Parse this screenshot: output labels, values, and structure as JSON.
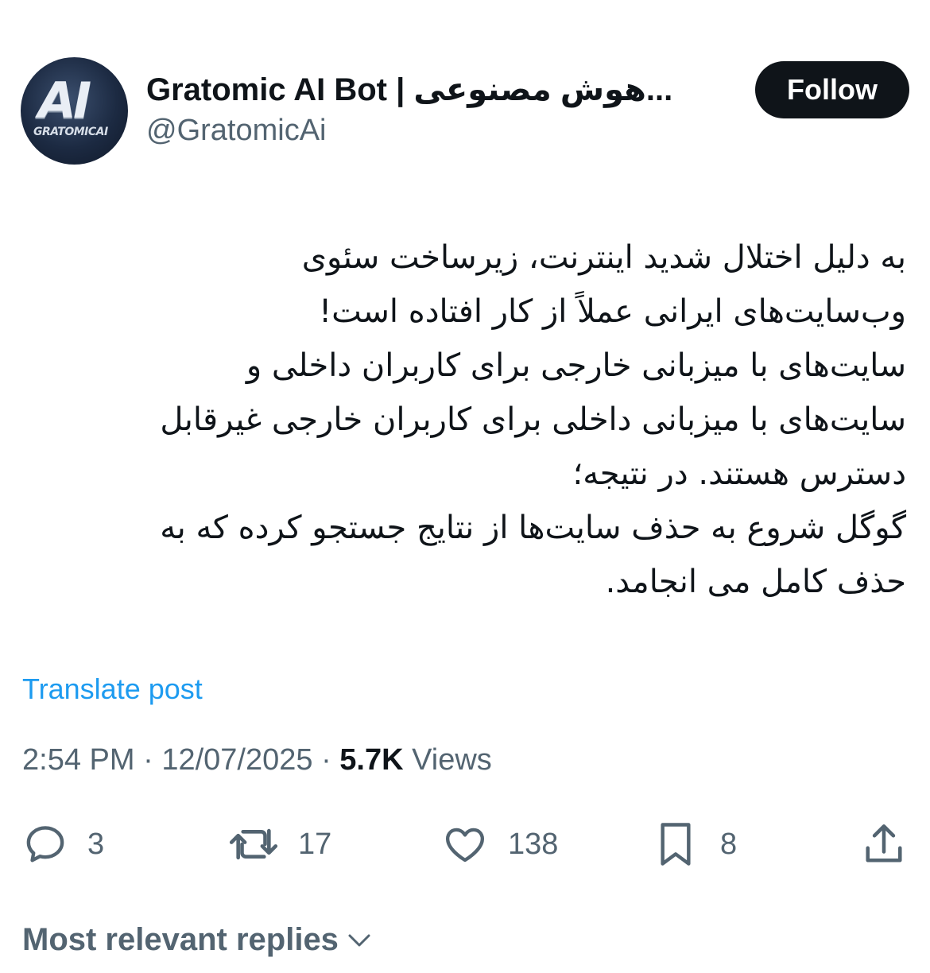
{
  "author": {
    "avatar_text": "AI",
    "avatar_brand": "GRATOMICAI",
    "display_name": "Gratomic AI Bot | هوش مصنوعی...",
    "handle": "@GratomicAi"
  },
  "follow_label": "Follow",
  "tweet": {
    "text": "به دلیل اختلال شدید اینترنت، زیرساخت سئوی\nوب‌سایت‌های ایرانی عملاً از کار افتاده است!\nسایت‌های با میزبانی خارجی برای کاربران داخلی و\nسایت‌های با میزبانی داخلی برای کاربران خارجی غیرقابل\nدسترس هستند. در نتیجه؛\nگوگل شروع به حذف سایت‌ها از نتایج جستجو کرده که به\nحذف کامل می انجامد."
  },
  "translate_label": "Translate post",
  "meta": {
    "time": "2:54 PM",
    "date": "12/07/2025",
    "views_count": "5.7K",
    "views_label": "Views",
    "separator": "·"
  },
  "actions": {
    "replies": "3",
    "reposts": "17",
    "likes": "138",
    "bookmarks": "8"
  },
  "icons": {
    "reply": "reply-bubble-icon",
    "repost": "repost-arrows-icon",
    "like": "heart-icon",
    "bookmark": "bookmark-icon",
    "share": "share-upload-icon",
    "chevron": "chevron-down-icon"
  },
  "colors": {
    "text": "#0f1419",
    "secondary": "#536471",
    "link": "#1d9bf0",
    "button": "#0f1419"
  },
  "replies_sort_label": "Most relevant replies"
}
